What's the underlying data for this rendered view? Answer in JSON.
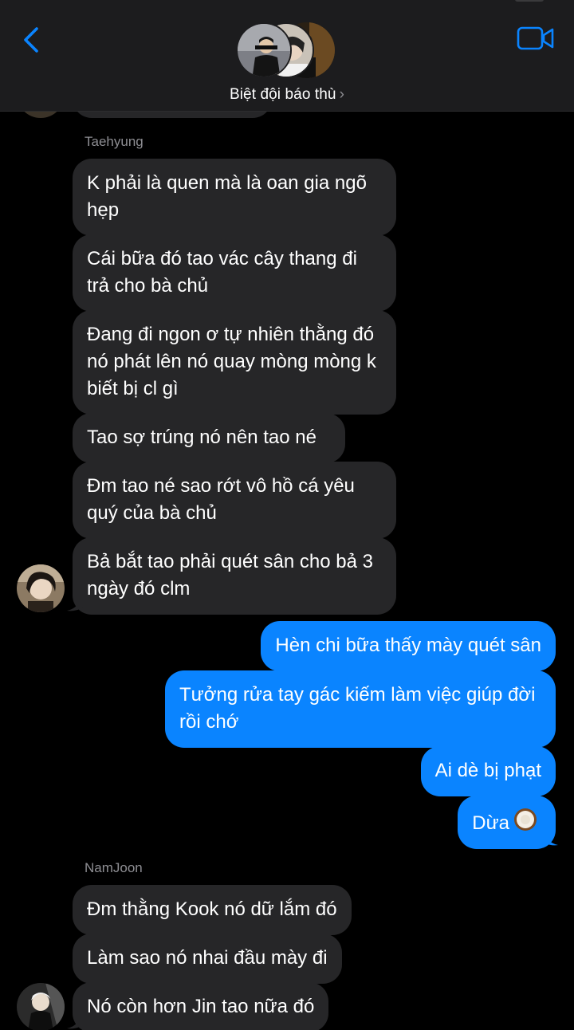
{
  "header": {
    "group_name": "Biệt đội báo thù",
    "chevron": "›",
    "back_icon": "chevron-left-icon",
    "video_icon": "video-camera-icon",
    "accent": "#0a84ff"
  },
  "messages": [
    {
      "sender": "Taehyung",
      "direction": "in",
      "text": "K phải là quen mà là oan gia ngõ hẹp"
    },
    {
      "sender": "Taehyung",
      "direction": "in",
      "text": "Cái bữa đó tao vác cây thang đi trả cho bà chủ"
    },
    {
      "sender": "Taehyung",
      "direction": "in",
      "text": "Đang đi ngon ơ tự nhiên thằng đó nó phát lên nó quay mòng mòng k biết bị cl gì"
    },
    {
      "sender": "Taehyung",
      "direction": "in",
      "text": "Tao sợ trúng nó nên tao né"
    },
    {
      "sender": "Taehyung",
      "direction": "in",
      "text": "Đm tao né sao rớt vô hồ cá yêu quý của bà chủ"
    },
    {
      "sender": "Taehyung",
      "direction": "in",
      "text": "Bả bắt tao phải quét sân cho bả 3 ngày đó clm"
    },
    {
      "sender": "me",
      "direction": "out",
      "text": "Hèn chi bữa thấy mày quét sân"
    },
    {
      "sender": "me",
      "direction": "out",
      "text": "Tưởng rửa tay gác kiếm làm việc giúp đời rồi chớ"
    },
    {
      "sender": "me",
      "direction": "out",
      "text": "Ai dè bị phạt"
    },
    {
      "sender": "me",
      "direction": "out",
      "text": "Dừa",
      "emoji": "coconut-emoji"
    },
    {
      "sender": "NamJoon",
      "direction": "in",
      "text": "Đm thằng Kook nó dữ lắm đó"
    },
    {
      "sender": "NamJoon",
      "direction": "in",
      "text": "Làm sao nó nhai đầu mày đi"
    },
    {
      "sender": "NamJoon",
      "direction": "in",
      "text": "Nó còn hơn Jin tao nữa đó"
    }
  ],
  "colors": {
    "background": "#000000",
    "header_bg": "#1c1c1e",
    "incoming_bubble": "#262628",
    "outgoing_bubble": "#0a84ff",
    "sender_name": "#8e8e93"
  }
}
